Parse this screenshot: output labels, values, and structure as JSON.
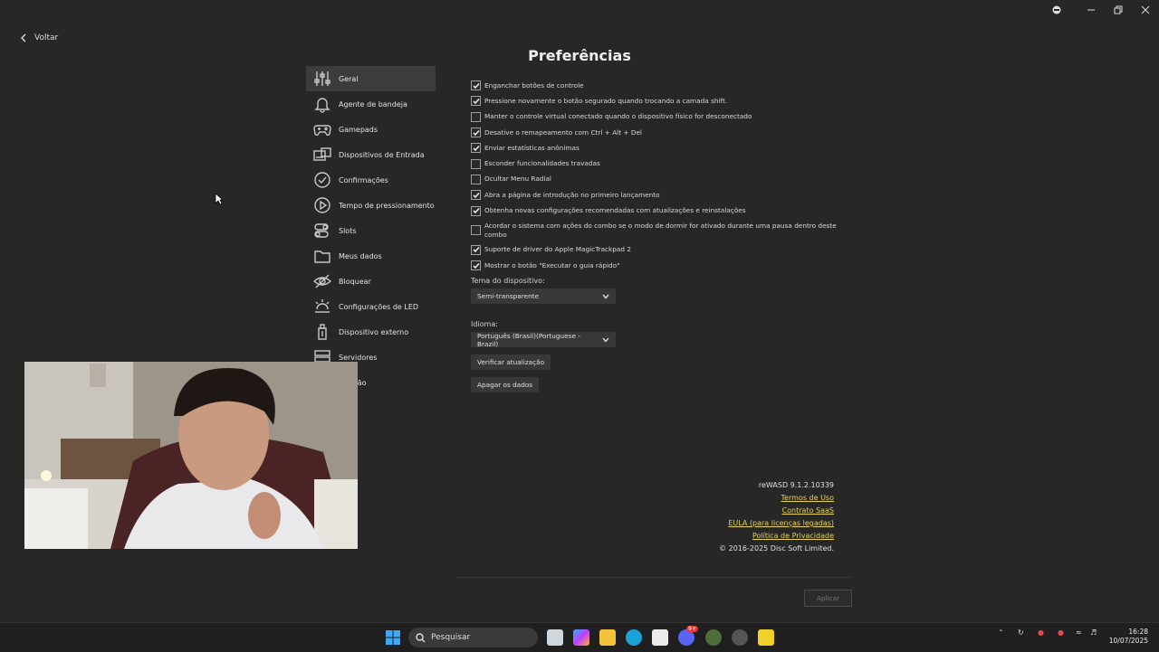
{
  "nav": {
    "back_label": "Voltar"
  },
  "page": {
    "title": "Preferências"
  },
  "sidebar": {
    "items": [
      {
        "label": "Geral",
        "icon": "sliders-icon",
        "active": true
      },
      {
        "label": "Agente de bandeja",
        "icon": "bell-icon"
      },
      {
        "label": "Gamepads",
        "icon": "gamepad-icon"
      },
      {
        "label": "Dispositivos de Entrada",
        "icon": "keyboard-icon"
      },
      {
        "label": "Confirmações",
        "icon": "check-circle-icon"
      },
      {
        "label": "Tempo de pressionamento",
        "icon": "play-timer-icon"
      },
      {
        "label": "Slots",
        "icon": "toggle-icon"
      },
      {
        "label": "Meus dados",
        "icon": "folder-icon"
      },
      {
        "label": "Bloquear",
        "icon": "eye-off-icon"
      },
      {
        "label": "Configurações de LED",
        "icon": "led-icon"
      },
      {
        "label": "Dispositivo externo",
        "icon": "usb-icon"
      },
      {
        "label": "Servidores",
        "icon": "server-icon"
      },
      {
        "label": "posição",
        "icon": "position-icon"
      }
    ]
  },
  "options": [
    {
      "label": "Enganchar botões de controle",
      "checked": true
    },
    {
      "label": "Pressione novamente o botão segurado quando trocando a camada shift.",
      "checked": true
    },
    {
      "label": "Manter o controle virtual conectado quando o dispositivo físico for desconectado",
      "checked": false
    },
    {
      "label": "Desative o remapeamento com Ctrl + Alt + Del",
      "checked": true
    },
    {
      "label": "Enviar estatísticas anônimas",
      "checked": true
    },
    {
      "label": "Esconder funcionalidades travadas",
      "checked": false
    },
    {
      "label": "Ocultar Menu Radial",
      "checked": false
    },
    {
      "label": "Abra a página de introdução no primeiro lançamento",
      "checked": true
    },
    {
      "label": "Obtenha novas configurações recomendadas com atualizações e reinstalações",
      "checked": true
    },
    {
      "label": "Acordar o sistema com ações do combo se o modo de dormir for ativado durante uma pausa dentro deste combo",
      "checked": false
    },
    {
      "label": "Suporte de driver do Apple MagicTrackpad 2",
      "checked": true
    },
    {
      "label": "Mostrar o botão \"Executar o guia rápido\"",
      "checked": true
    }
  ],
  "theme": {
    "label": "Tema do dispositivo:",
    "value": "Semi-transparente"
  },
  "language": {
    "label": "Idioma:",
    "value": "Português (Brasil)(Portuguese - Brazil)"
  },
  "buttons": {
    "check_update": "Verificar atualização",
    "clear_data": "Apagar os dados",
    "apply": "Aplicar"
  },
  "info": {
    "version": "reWASD 9.1.2.10339",
    "terms": "Termos de Uso",
    "saas": "Contrato SaaS",
    "eula": "EULA (para licenças legadas)",
    "privacy": "Política de Privacidade",
    "copyright": "© 2016-2025 Disc Soft Limited."
  },
  "taskbar": {
    "search_placeholder": "Pesquisar",
    "time": "16:28",
    "date": "10/07/2025",
    "badge": "9+"
  },
  "colors": {
    "background": "#272727",
    "link": "#e8d44a",
    "active_item": "#3c3c3c"
  }
}
